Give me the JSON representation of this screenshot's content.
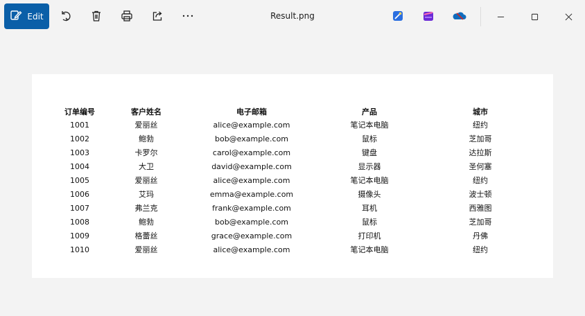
{
  "toolbar": {
    "edit_label": "Edit",
    "icons": [
      "edit-icon",
      "rotate-icon",
      "delete-icon",
      "print-icon",
      "share-icon",
      "more-icon"
    ]
  },
  "window": {
    "title": "Result.png",
    "controls": [
      "minimize-icon",
      "maximize-icon",
      "close-icon"
    ]
  },
  "apps": [
    "designer-app-icon",
    "clipchamp-app-icon",
    "onedrive-icon"
  ],
  "table": {
    "headers": [
      "订单编号",
      "客户姓名",
      "电子邮箱",
      "产品",
      "城市"
    ],
    "rows": [
      [
        "1001",
        "爱丽丝",
        "alice@example.com",
        "笔记本电脑",
        "纽约"
      ],
      [
        "1002",
        "鲍勃",
        "bob@example.com",
        "鼠标",
        "芝加哥"
      ],
      [
        "1003",
        "卡罗尔",
        "carol@example.com",
        "键盘",
        "达拉斯"
      ],
      [
        "1004",
        "大卫",
        "david@example.com",
        "显示器",
        "圣何塞"
      ],
      [
        "1005",
        "爱丽丝",
        "alice@example.com",
        "笔记本电脑",
        "纽约"
      ],
      [
        "1006",
        "艾玛",
        "emma@example.com",
        "摄像头",
        "波士顿"
      ],
      [
        "1007",
        "弗兰克",
        "frank@example.com",
        "耳机",
        "西雅图"
      ],
      [
        "1008",
        "鲍勃",
        "bob@example.com",
        "鼠标",
        "芝加哥"
      ],
      [
        "1009",
        "格蕾丝",
        "grace@example.com",
        "打印机",
        "丹佛"
      ],
      [
        "1010",
        "爱丽丝",
        "alice@example.com",
        "笔记本电脑",
        "纽约"
      ]
    ]
  },
  "colors": {
    "accent": "#0a5fa8",
    "background": "#f3f3f3",
    "canvas": "#ffffff"
  }
}
